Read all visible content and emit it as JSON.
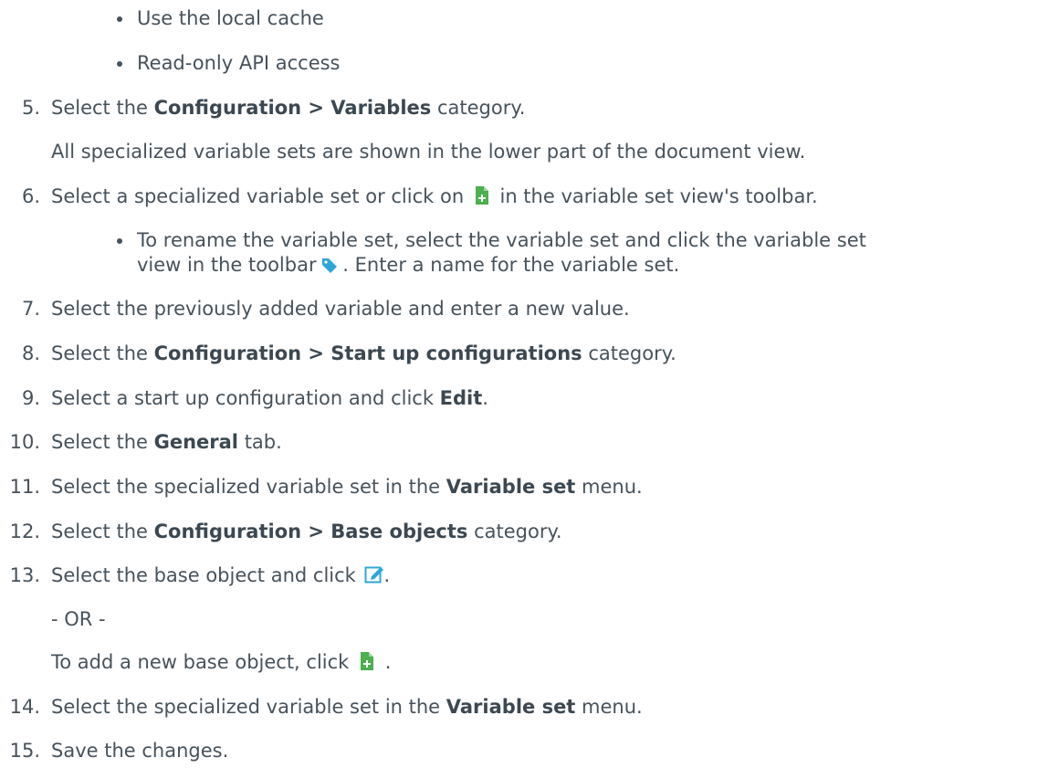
{
  "bullets_top": [
    "Use the local cache",
    "Read-only API access"
  ],
  "steps": [
    {
      "num": "5.",
      "pre": "Select the ",
      "bold": "Configuration > Variables",
      "post": " category."
    },
    {
      "num": "6.",
      "pre": "Select a specialized variable set or click on ",
      "icon": "add-document-icon",
      "post": " in the variable set view's toolbar."
    },
    {
      "num": "7.",
      "text": "Select the previously added variable and enter a new value."
    },
    {
      "num": "8.",
      "pre": "Select the ",
      "bold": "Configuration > Start up configurations",
      "post": " category."
    },
    {
      "num": "9.",
      "pre": "Select a start up configuration and click ",
      "bold": "Edit",
      "post": "."
    },
    {
      "num": "10.",
      "pre": "Select the ",
      "bold": "General",
      "post": " tab."
    },
    {
      "num": "11.",
      "pre": "Select the specialized variable set in the ",
      "bold": "Variable set",
      "post": " menu."
    },
    {
      "num": "12.",
      "pre": "Select the ",
      "bold": "Configuration > Base objects",
      "post": " category."
    },
    {
      "num": "13.",
      "pre": "Select the base object and click ",
      "icon": "edit-icon",
      "post": "."
    },
    {
      "num": "14.",
      "pre": "Select the specialized variable set in the ",
      "bold": "Variable set",
      "post": " menu."
    },
    {
      "num": "15.",
      "text": "Save the changes."
    }
  ],
  "step5_note": "All specialized variable sets are shown in the lower part of the document view.",
  "step6_sub": {
    "line1": "To rename the variable set, select the variable set and click the variable set",
    "line2_pre": "view in the toolbar ",
    "line2_icon": "tag-icon",
    "line2_post": ". Enter a name for the variable set."
  },
  "step13_or": "- OR -",
  "step13_alt_pre": "To add a new base object, click ",
  "step13_alt_icon": "add-document-icon",
  "step13_alt_post": " .",
  "colors": {
    "text": "#47525b",
    "icon_green": "#4caf50",
    "icon_blue": "#2fa6d9"
  }
}
